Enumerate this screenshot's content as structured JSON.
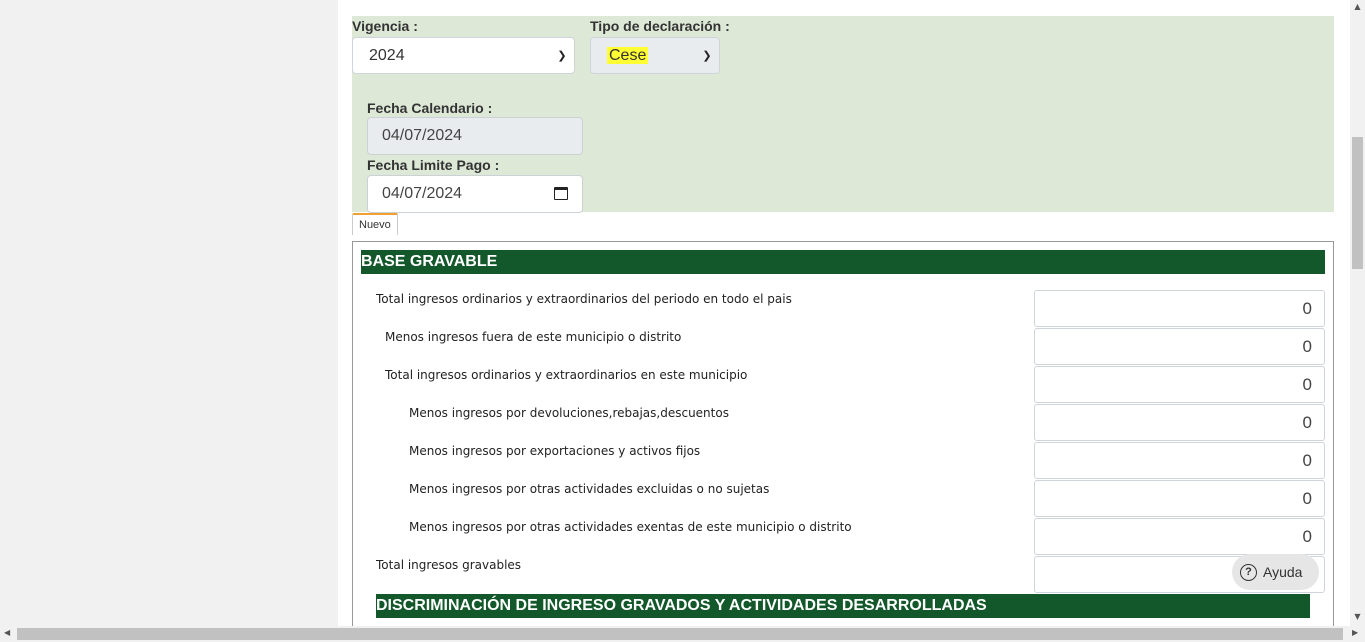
{
  "form": {
    "vigencia_label": "Vigencia :",
    "vigencia_value": "2024",
    "tipo_label": "Tipo de declaración :",
    "tipo_value": "Cese",
    "fecha_calendario_label": "Fecha Calendario :",
    "fecha_calendario_value": "04/07/2024",
    "fecha_limite_label": "Fecha Limite Pago :",
    "fecha_limite_value": "04/07/2024"
  },
  "tab": {
    "label": "Nuevo"
  },
  "base_gravable": {
    "title": "BASE GRAVABLE",
    "rows": [
      {
        "label": "Total ingresos ordinarios y extraordinarios del periodo en todo el pais",
        "value": "0"
      },
      {
        "label": "Menos ingresos fuera de este municipio o distrito",
        "value": "0"
      },
      {
        "label": "Total ingresos ordinarios y extraordinarios en este municipio",
        "value": "0"
      },
      {
        "label": "Menos ingresos por devoluciones,rebajas,descuentos",
        "value": "0"
      },
      {
        "label": "Menos ingresos por exportaciones y activos fijos",
        "value": "0"
      },
      {
        "label": "Menos ingresos por otras actividades excluidas o no sujetas",
        "value": "0"
      },
      {
        "label": "Menos ingresos por otras actividades exentas de este municipio o distrito",
        "value": "0"
      },
      {
        "label": "Total ingresos gravables",
        "value": ""
      }
    ]
  },
  "discriminacion": {
    "title": "DISCRIMINACIÓN DE INGRESO GRAVADOS Y ACTIVIDADES DESARROLLADAS"
  },
  "help": {
    "label": "Ayuda"
  },
  "colors": {
    "panel": "#dde8d7",
    "header": "#13582a",
    "highlight": "#ffff33",
    "tab_accent": "#f0a030"
  }
}
